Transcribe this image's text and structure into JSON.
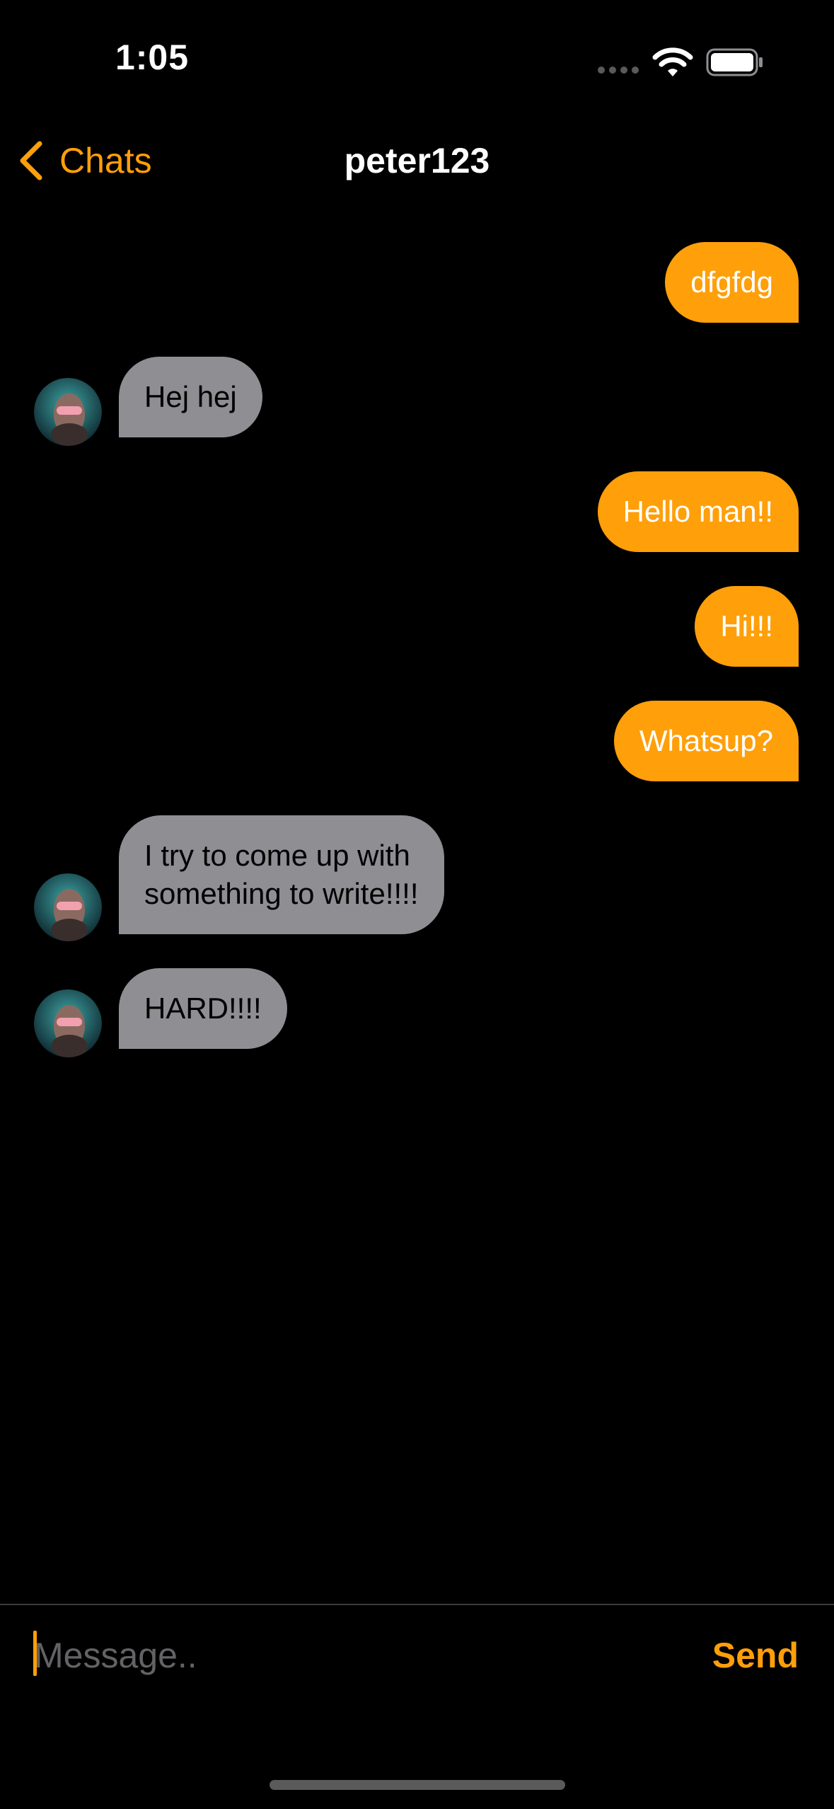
{
  "status_bar": {
    "time": "1:05",
    "icons": [
      "cellular-signal-icon",
      "wifi-icon",
      "battery-icon"
    ]
  },
  "nav": {
    "back_label": "Chats",
    "back_icon": "chevron-left-icon",
    "title": "peter123"
  },
  "colors": {
    "accent": "#ff9f0a",
    "sent_bubble": "#ff9f0a",
    "received_bubble": "#8e8e93",
    "background": "#000000"
  },
  "messages": [
    {
      "direction": "sent",
      "text": "dfgfdg"
    },
    {
      "direction": "received",
      "text": "Hej hej",
      "avatar": "user-avatar"
    },
    {
      "direction": "sent",
      "text": "Hello man!!"
    },
    {
      "direction": "sent",
      "text": "Hi!!!"
    },
    {
      "direction": "sent",
      "text": "Whatsup?"
    },
    {
      "direction": "received",
      "text": "I try to come up with\nsomething to write!!!!",
      "avatar": "user-avatar"
    },
    {
      "direction": "received",
      "text": "HARD!!!!",
      "avatar": "user-avatar"
    }
  ],
  "composer": {
    "placeholder": "Message..",
    "value": "",
    "send_label": "Send"
  }
}
